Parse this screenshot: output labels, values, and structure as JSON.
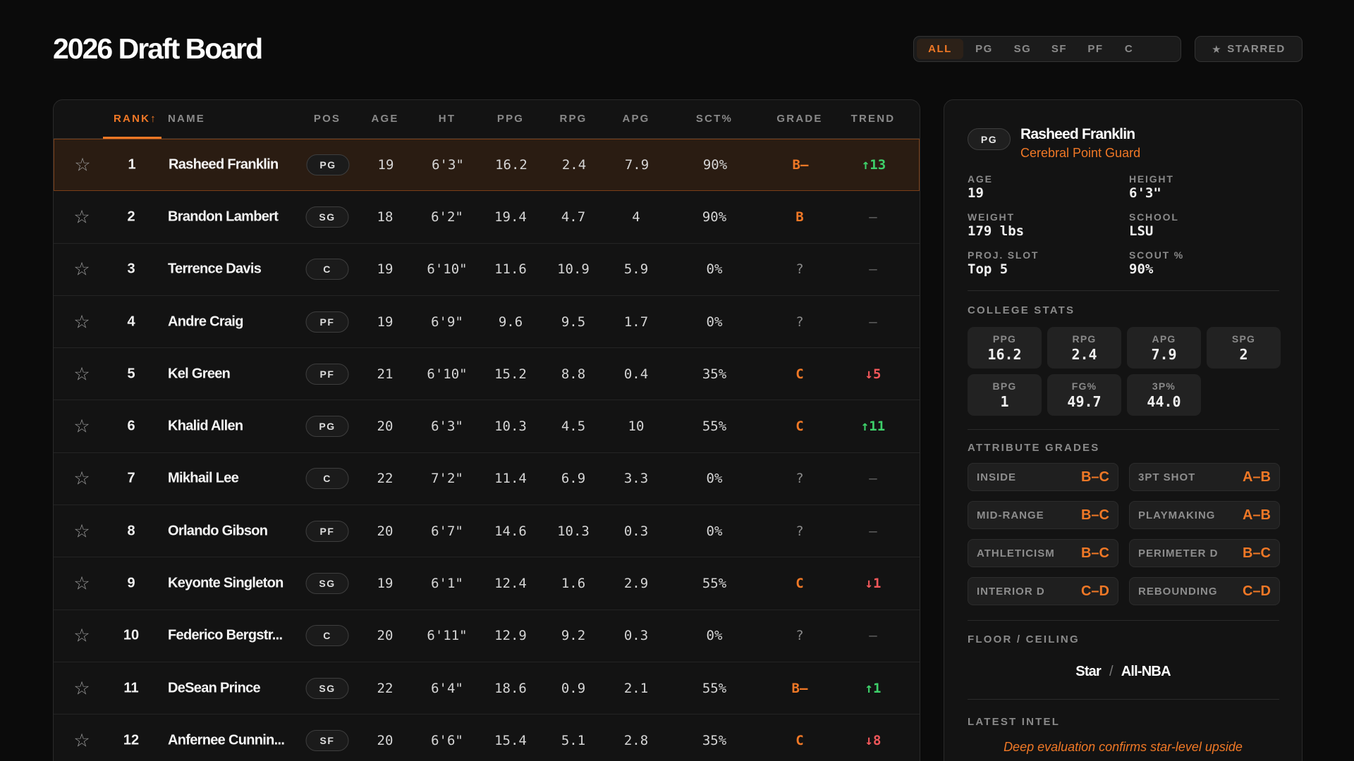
{
  "page_title": "2026 Draft Board",
  "filters": {
    "options": [
      "ALL",
      "PG",
      "SG",
      "SF",
      "PF",
      "C"
    ],
    "active": "ALL",
    "starred_label": "STARRED",
    "starred_icon": "star-icon"
  },
  "table": {
    "columns": {
      "rank": "RANK",
      "sort_indicator": "↑",
      "name": "NAME",
      "pos": "POS",
      "age": "AGE",
      "ht": "HT",
      "ppg": "PPG",
      "rpg": "RPG",
      "apg": "APG",
      "sct": "SCT%",
      "grade": "GRADE",
      "trend": "TREND"
    },
    "selected_rank": 1,
    "rows": [
      {
        "rank": "1",
        "name": "Rasheed Franklin",
        "pos": "PG",
        "age": "19",
        "ht": "6'3\"",
        "ppg": "16.2",
        "rpg": "2.4",
        "apg": "7.9",
        "sct": "90%",
        "grade": "B–",
        "trend": "↑13",
        "trend_dir": "up"
      },
      {
        "rank": "2",
        "name": "Brandon Lambert",
        "pos": "SG",
        "age": "18",
        "ht": "6'2\"",
        "ppg": "19.4",
        "rpg": "4.7",
        "apg": "4",
        "sct": "90%",
        "grade": "B",
        "trend": "—",
        "trend_dir": "flat"
      },
      {
        "rank": "3",
        "name": "Terrence Davis",
        "pos": "C",
        "age": "19",
        "ht": "6'10\"",
        "ppg": "11.6",
        "rpg": "10.9",
        "apg": "5.9",
        "sct": "0%",
        "grade": "?",
        "trend": "—",
        "trend_dir": "flat"
      },
      {
        "rank": "4",
        "name": "Andre Craig",
        "pos": "PF",
        "age": "19",
        "ht": "6'9\"",
        "ppg": "9.6",
        "rpg": "9.5",
        "apg": "1.7",
        "sct": "0%",
        "grade": "?",
        "trend": "—",
        "trend_dir": "flat"
      },
      {
        "rank": "5",
        "name": "Kel Green",
        "pos": "PF",
        "age": "21",
        "ht": "6'10\"",
        "ppg": "15.2",
        "rpg": "8.8",
        "apg": "0.4",
        "sct": "35%",
        "grade": "C",
        "trend": "↓5",
        "trend_dir": "down"
      },
      {
        "rank": "6",
        "name": "Khalid Allen",
        "pos": "PG",
        "age": "20",
        "ht": "6'3\"",
        "ppg": "10.3",
        "rpg": "4.5",
        "apg": "10",
        "sct": "55%",
        "grade": "C",
        "trend": "↑11",
        "trend_dir": "up"
      },
      {
        "rank": "7",
        "name": "Mikhail Lee",
        "pos": "C",
        "age": "22",
        "ht": "7'2\"",
        "ppg": "11.4",
        "rpg": "6.9",
        "apg": "3.3",
        "sct": "0%",
        "grade": "?",
        "trend": "—",
        "trend_dir": "flat"
      },
      {
        "rank": "8",
        "name": "Orlando Gibson",
        "pos": "PF",
        "age": "20",
        "ht": "6'7\"",
        "ppg": "14.6",
        "rpg": "10.3",
        "apg": "0.3",
        "sct": "0%",
        "grade": "?",
        "trend": "—",
        "trend_dir": "flat"
      },
      {
        "rank": "9",
        "name": "Keyonte Singleton",
        "pos": "SG",
        "age": "19",
        "ht": "6'1\"",
        "ppg": "12.4",
        "rpg": "1.6",
        "apg": "2.9",
        "sct": "55%",
        "grade": "C",
        "trend": "↓1",
        "trend_dir": "down"
      },
      {
        "rank": "10",
        "name": "Federico Bergstr...",
        "pos": "C",
        "age": "20",
        "ht": "6'11\"",
        "ppg": "12.9",
        "rpg": "9.2",
        "apg": "0.3",
        "sct": "0%",
        "grade": "?",
        "trend": "—",
        "trend_dir": "flat"
      },
      {
        "rank": "11",
        "name": "DeSean Prince",
        "pos": "SG",
        "age": "22",
        "ht": "6'4\"",
        "ppg": "18.6",
        "rpg": "0.9",
        "apg": "2.1",
        "sct": "55%",
        "grade": "B–",
        "trend": "↑1",
        "trend_dir": "up"
      },
      {
        "rank": "12",
        "name": "Anfernee Cunnin...",
        "pos": "SF",
        "age": "20",
        "ht": "6'6\"",
        "ppg": "15.4",
        "rpg": "5.1",
        "apg": "2.8",
        "sct": "35%",
        "grade": "C",
        "trend": "↓8",
        "trend_dir": "down"
      }
    ]
  },
  "detail": {
    "pos": "PG",
    "name": "Rasheed Franklin",
    "archetype": "Cerebral Point Guard",
    "info": [
      {
        "label": "AGE",
        "value": "19"
      },
      {
        "label": "HEIGHT",
        "value": "6'3\""
      },
      {
        "label": "WEIGHT",
        "value": "179 lbs"
      },
      {
        "label": "SCHOOL",
        "value": "LSU"
      },
      {
        "label": "PROJ. SLOT",
        "value": "Top 5"
      },
      {
        "label": "SCOUT %",
        "value": "90%"
      }
    ],
    "college_stats_label": "COLLEGE STATS",
    "college_stats": [
      {
        "label": "PPG",
        "value": "16.2"
      },
      {
        "label": "RPG",
        "value": "2.4"
      },
      {
        "label": "APG",
        "value": "7.9"
      },
      {
        "label": "SPG",
        "value": "2"
      },
      {
        "label": "BPG",
        "value": "1"
      },
      {
        "label": "FG%",
        "value": "49.7"
      },
      {
        "label": "3P%",
        "value": "44.0"
      }
    ],
    "attribute_grades_label": "ATTRIBUTE GRADES",
    "attribute_grades": [
      {
        "name": "INSIDE",
        "grade": "B–C"
      },
      {
        "name": "3PT SHOT",
        "grade": "A–B"
      },
      {
        "name": "MID-RANGE",
        "grade": "B–C"
      },
      {
        "name": "PLAYMAKING",
        "grade": "A–B"
      },
      {
        "name": "ATHLETICISM",
        "grade": "B–C"
      },
      {
        "name": "PERIMETER D",
        "grade": "B–C"
      },
      {
        "name": "INTERIOR D",
        "grade": "C–D"
      },
      {
        "name": "REBOUNDING",
        "grade": "C–D"
      }
    ],
    "floor_ceiling_label": "FLOOR / CEILING",
    "floor": "Star",
    "ceiling_separator": "/",
    "ceiling": "All-NBA",
    "latest_intel_label": "LATEST INTEL",
    "latest_intel": "Deep evaluation confirms star-level upside"
  },
  "colors": {
    "accent": "#f07826",
    "up": "#3ed06a",
    "down": "#f0575a",
    "background": "#0b0b0b",
    "card": "#131313",
    "selected_row": "#2a1c12"
  }
}
